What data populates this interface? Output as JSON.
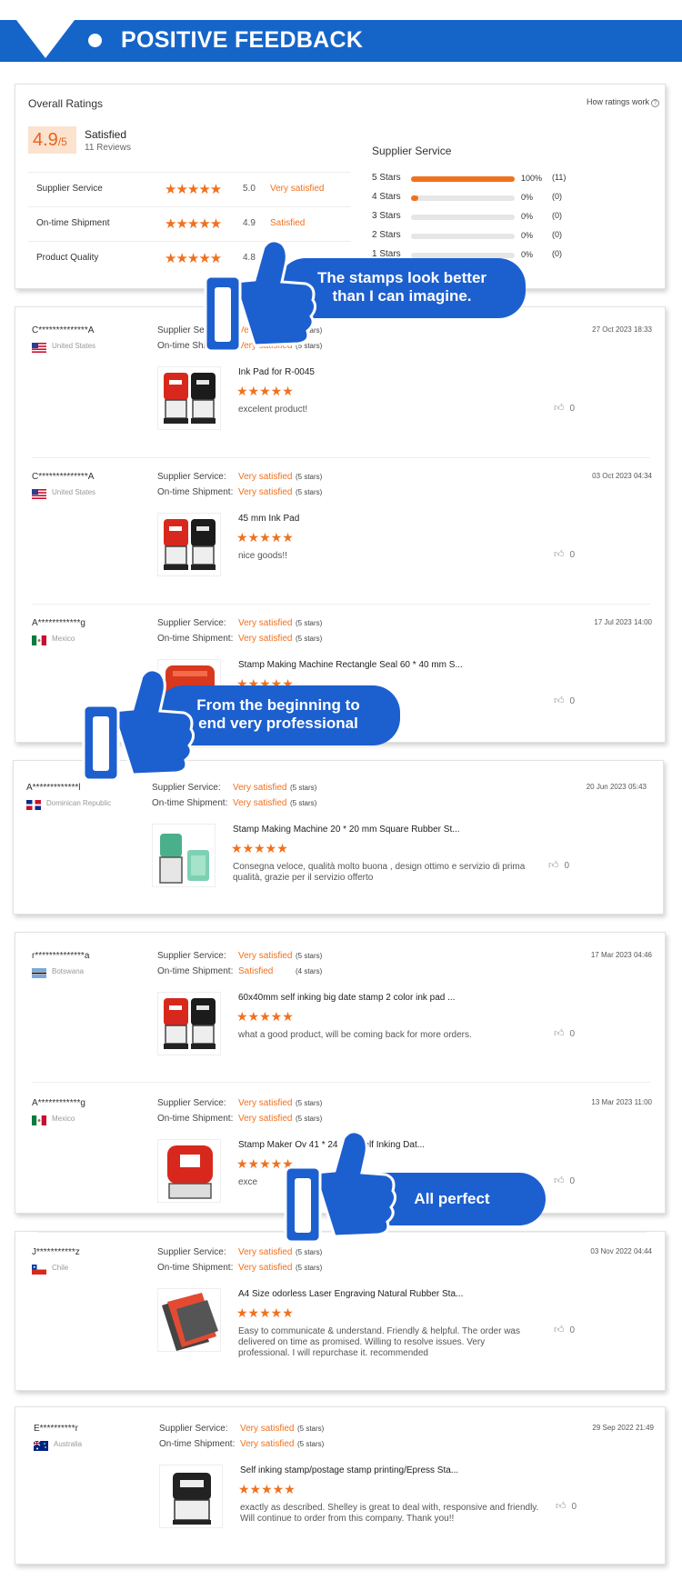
{
  "banner": {
    "title": "POSITIVE FEEDBACK"
  },
  "overall": {
    "title": "Overall Ratings",
    "how_link": "How ratings work",
    "info": "?",
    "score": "4.9",
    "score_max": "/5",
    "status": "Satisfied",
    "reviews": "11 Reviews",
    "rows": [
      {
        "label": "Supplier Service",
        "stars": "★★★★★",
        "value": "5.0",
        "text": "Very satisfied"
      },
      {
        "label": "On-time Shipment",
        "stars": "★★★★★",
        "value": "4.9",
        "text": "Satisfied"
      },
      {
        "label": "Product Quality",
        "stars": "★★★★★",
        "value": "4.8",
        "text": ""
      }
    ],
    "supplier_title": "Supplier Service",
    "bars": [
      {
        "label": "5 Stars",
        "fill": 1.0,
        "pct": "100%",
        "count": "(11)"
      },
      {
        "label": "4 Stars",
        "fill": 0.07,
        "pct": "0%",
        "count": "(0)"
      },
      {
        "label": "3 Stars",
        "fill": 0,
        "pct": "0%",
        "count": "(0)"
      },
      {
        "label": "2 Stars",
        "fill": 0,
        "pct": "0%",
        "count": "(0)"
      },
      {
        "label": "1 Stars",
        "fill": 0,
        "pct": "0%",
        "count": "(0)"
      }
    ]
  },
  "labels": {
    "supplier": "Supplier Service:",
    "shipment": "On-time Shipment:",
    "like_count": "0"
  },
  "reviews": [
    {
      "name": "C**************A",
      "country": "United States",
      "supplier_val": "Very satisfied",
      "supplier_sub": "(5 stars)",
      "ship_val": "Very satisfied",
      "ship_sub": "(5 stars)",
      "date": "27 Oct 2023 18:33",
      "product": "Ink Pad for R-0045",
      "stars": "★★★★★",
      "text": "excelent product!"
    },
    {
      "name": "C**************A",
      "country": "United States",
      "supplier_val": "Very satisfied",
      "supplier_sub": "(5 stars)",
      "ship_val": "Very satisfied",
      "ship_sub": "(5 stars)",
      "date": "03 Oct 2023 04:34",
      "product": "45 mm Ink Pad",
      "stars": "★★★★★",
      "text": "nice goods!!"
    },
    {
      "name": "A************g",
      "country": "Mexico",
      "supplier_val": "Very satisfied",
      "supplier_sub": "(5 stars)",
      "ship_val": "Very satisfied",
      "ship_sub": "(5 stars)",
      "date": "17 Jul 2023 14:00",
      "product": "Stamp Making Machine Rectangle Seal 60 * 40 mm S...",
      "stars": "★★★★★",
      "text": ""
    },
    {
      "name": "A*************l",
      "country": "Dominican Republic",
      "supplier_val": "Very satisfied",
      "supplier_sub": "(5 stars)",
      "ship_val": "Very satisfied",
      "ship_sub": "(5 stars)",
      "date": "20 Jun 2023 05:43",
      "product": "Stamp Making Machine 20 * 20 mm Square Rubber St...",
      "stars": "★★★★★",
      "text": "Consegna veloce, qualità molto buona , design ottimo e servizio di prima qualità, grazie per il servizio offerto"
    },
    {
      "name": "r**************a",
      "country": "Botswana",
      "supplier_val": "Very satisfied",
      "supplier_sub": "(5 stars)",
      "ship_val": "Satisfied",
      "ship_sub": "(4 stars)",
      "date": "17 Mar 2023 04:46",
      "product": "60x40mm self inking big date stamp 2 color ink pad ...",
      "stars": "★★★★★",
      "text": "what a good product, will be coming back for more orders."
    },
    {
      "name": "A************g",
      "country": "Mexico",
      "supplier_val": "Very satisfied",
      "supplier_sub": "(5 stars)",
      "ship_val": "Very satisfied",
      "ship_sub": "(5 stars)",
      "date": "13 Mar 2023 11:00",
      "product": "Stamp Maker Ov      41 * 24 mm Self Inking Dat...",
      "stars": "★★★★★",
      "text": "exce"
    },
    {
      "name": "J***********z",
      "country": "Chile",
      "supplier_val": "Very satisfied",
      "supplier_sub": "(5 stars)",
      "ship_val": "Very satisfied",
      "ship_sub": "(5 stars)",
      "date": "03 Nov 2022 04:44",
      "product": "A4 Size odorless Laser Engraving Natural Rubber Sta...",
      "stars": "★★★★★",
      "text": "Easy to communicate & understand. Friendly & helpful. The order was delivered on time as promised. Willing to resolve issues. Very professional. I will repurchase it. recommended"
    },
    {
      "name": "E**********r",
      "country": "Australia",
      "supplier_val": "Very satisfied",
      "supplier_sub": "(5 stars)",
      "ship_val": "Very satisfied",
      "ship_sub": "(5 stars)",
      "date": "29 Sep 2022 21:49",
      "product": "Self inking stamp/postage stamp printing/Epress Sta...",
      "stars": "★★★★★",
      "text": "exactly as described. Shelley is great to deal with, responsive and friendly. Will continue to order from this company. Thank you!!"
    }
  ],
  "callouts": [
    {
      "line1": "The stamps look better",
      "line2": "than I can imagine."
    },
    {
      "line1": "From the beginning to",
      "line2": "end very professional"
    },
    {
      "line1": "All perfect",
      "line2": ""
    }
  ],
  "colors": {
    "brand_blue": "#1565c9",
    "accent_orange": "#f0711e"
  }
}
